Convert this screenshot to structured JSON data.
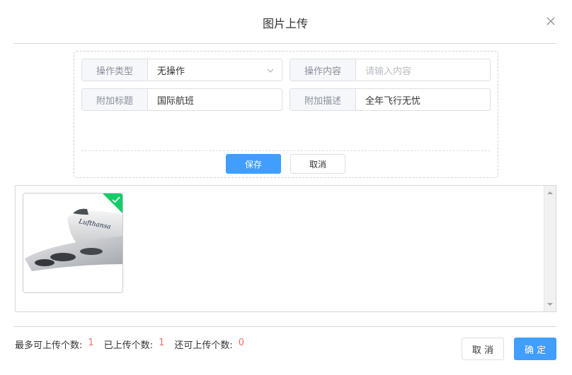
{
  "dialog": {
    "title": "图片上传"
  },
  "form": {
    "row1": {
      "type_label": "操作类型",
      "type_value": "无操作",
      "content_label": "操作内容",
      "content_placeholder": "请输入内容"
    },
    "row2": {
      "title_label": "附加标题",
      "title_value": "国际航班",
      "desc_label": "附加描述",
      "desc_value": "全年飞行无忧"
    },
    "save_label": "保存",
    "cancel_label": "取消"
  },
  "gallery": {
    "selected": true,
    "image_logo_text": "Lufthansa"
  },
  "footer": {
    "max_label": "最多可上传个数:",
    "max_value": "1",
    "uploaded_label": "已上传个数:",
    "uploaded_value": "1",
    "remaining_label": "还可上传个数:",
    "remaining_value": "0",
    "cancel_label": "取 消",
    "confirm_label": "确 定"
  },
  "colors": {
    "primary": "#409eff",
    "success": "#13ce66",
    "danger": "#f56c6c"
  }
}
